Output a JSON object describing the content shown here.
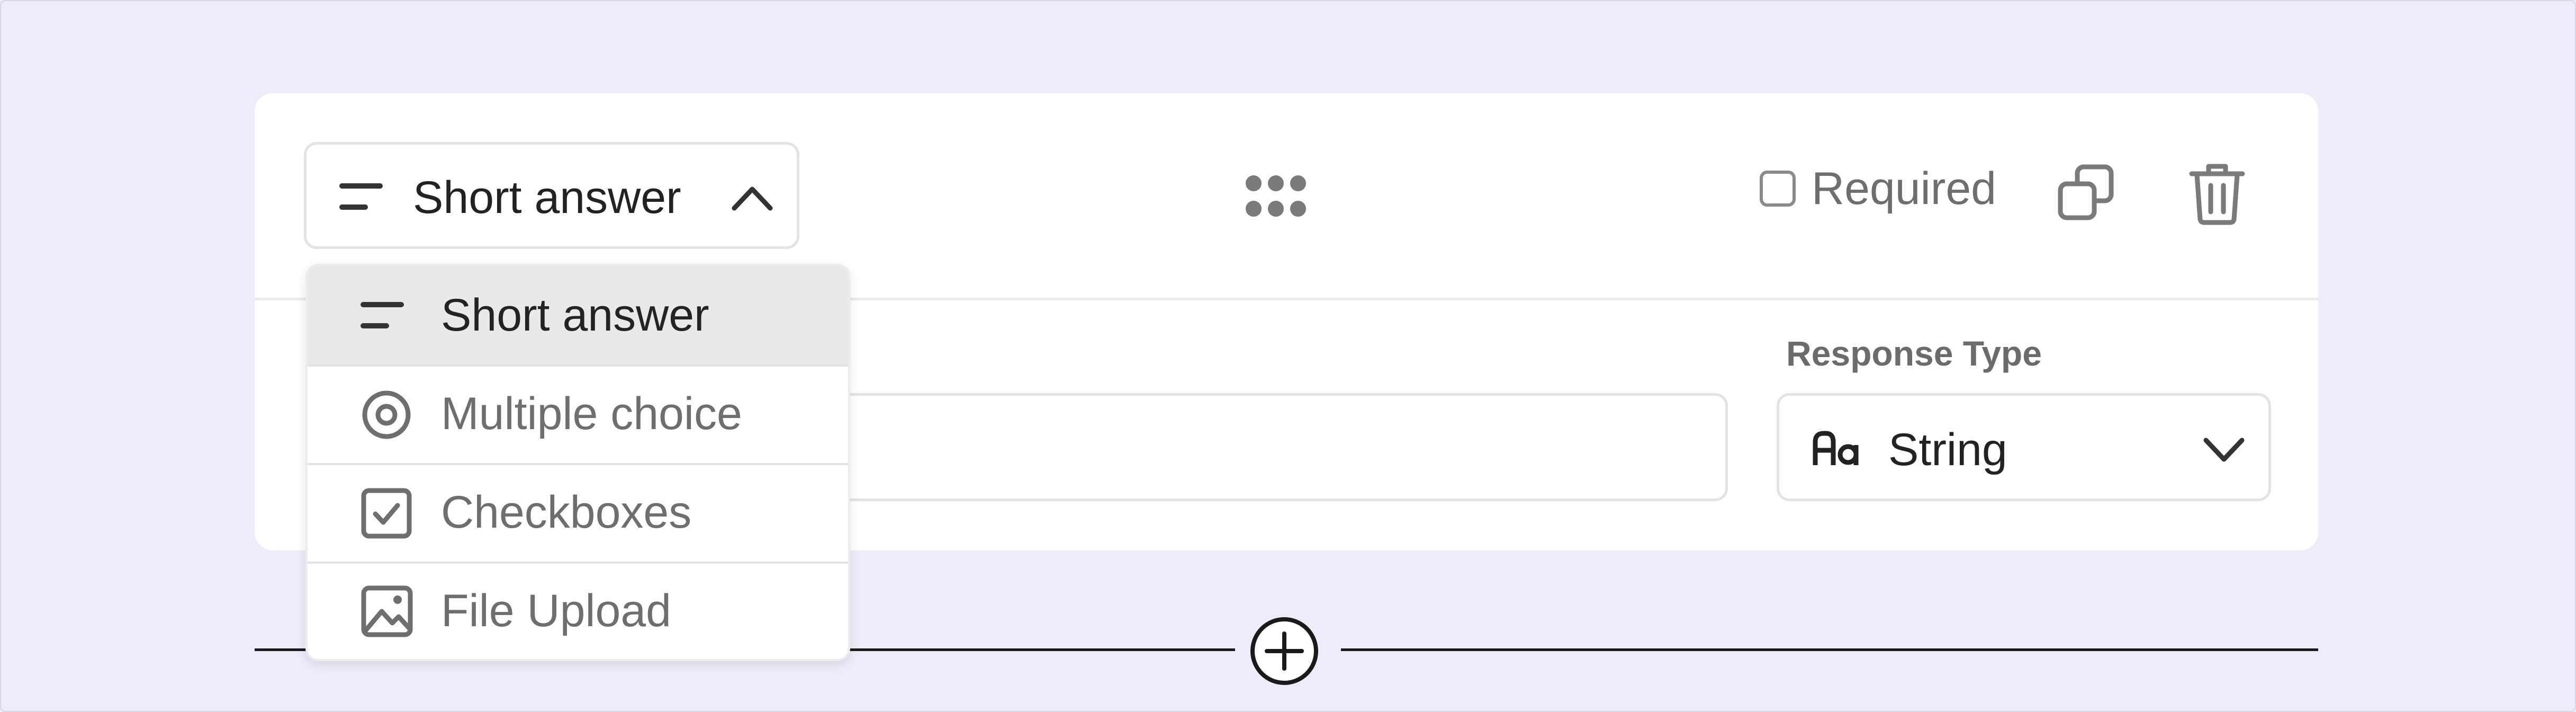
{
  "question_card": {
    "type_selector": {
      "selected_label": "Short answer",
      "icon": "short-answer-icon",
      "state": "open"
    },
    "required": {
      "label": "Required",
      "checked": false
    },
    "response_type": {
      "label": "Response Type",
      "value": "String",
      "icon": "text-format-icon"
    }
  },
  "type_menu": {
    "items": [
      {
        "label": "Short answer",
        "icon": "short-answer-icon",
        "selected": true
      },
      {
        "label": "Multiple choice",
        "icon": "radio-target-icon",
        "selected": false
      },
      {
        "label": "Checkboxes",
        "icon": "checkbox-checked-icon",
        "selected": false
      },
      {
        "label": "File Upload",
        "icon": "image-icon",
        "selected": false
      }
    ]
  },
  "colors": {
    "page_bg": "#efebf8",
    "card_bg": "#ffffff",
    "selected_item_bg": "#e9e9e9",
    "muted_text": "#6e6e6e",
    "primary_text": "#222222"
  }
}
